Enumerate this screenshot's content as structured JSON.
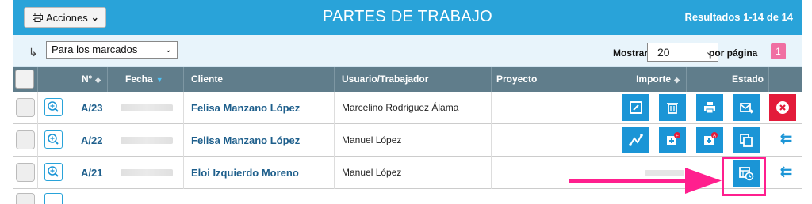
{
  "toolbar": {
    "actions_label": "Acciones",
    "title": "PARTES DE TRABAJO",
    "results": "Resultados 1-14 de 14"
  },
  "filter": {
    "marked_option": "Para los marcados",
    "mostrar_label": "Mostrar",
    "page_size": "20",
    "per_page_label": "por página",
    "page_number": "1"
  },
  "columns": {
    "number": "Nº",
    "date": "Fecha",
    "client": "Cliente",
    "user": "Usuario/Trabajador",
    "project": "Proyecto",
    "amount": "Importe",
    "status": "Estado"
  },
  "rows": [
    {
      "number": "A/23",
      "client": "Felisa Manzano López",
      "user": "Marcelino Rodriguez Álama"
    },
    {
      "number": "A/22",
      "client": "Felisa Manzano López",
      "user": "Manuel López"
    },
    {
      "number": "A/21",
      "client": "Eloi Izquierdo Moreno",
      "user": "Manuel López"
    }
  ],
  "colors": {
    "header_blue": "#29a3d9",
    "table_header": "#607d8b",
    "action_blue": "#1b95d6",
    "delete_red": "#e31b3a",
    "annotation_pink": "#ff1f8e"
  },
  "icons": [
    "printer-icon",
    "chevron-down-icon",
    "return-arrow-icon",
    "zoom-icon",
    "edit-icon",
    "trash-icon",
    "print-icon",
    "email-icon",
    "close-icon",
    "workflow-icon",
    "add-f-icon",
    "add-a-icon",
    "copy-icon",
    "invoice-icon",
    "back-arrow-icon"
  ]
}
